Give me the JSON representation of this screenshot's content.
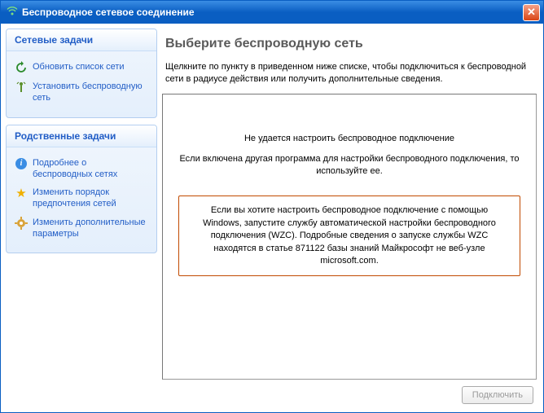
{
  "window": {
    "title": "Беспроводное сетевое соединение"
  },
  "sidebar": {
    "panel1": {
      "header": "Сетевые задачи",
      "items": [
        {
          "label": "Обновить список сети"
        },
        {
          "label": "Установить беспроводную сеть"
        }
      ]
    },
    "panel2": {
      "header": "Родственные задачи",
      "items": [
        {
          "label": "Подробнее о беспроводных сетях"
        },
        {
          "label": "Изменить порядок предпочтения  сетей"
        },
        {
          "label": "Изменить дополнительные параметры"
        }
      ]
    }
  },
  "main": {
    "title": "Выберите беспроводную сеть",
    "instruction": "Щелкните по пункту в приведенном ниже списке, чтобы подключиться к беспроводной сети в радиусе действия или получить дополнительные сведения.",
    "error_heading": "Не удается настроить беспроводное подключение",
    "error_detail": "Если включена другая программа для настройки беспроводного подключения, то\nиспользуйте ее.",
    "help_text": "Если вы хотите настроить беспроводное подключение с помощью Windows, запустите службу автоматической настройки беспроводного подключения (WZC). Подробные сведения о запуске службы WZC находятся в статье 871122 базы знаний Майкрософт не веб-узле microsoft.com."
  },
  "buttons": {
    "connect": "Подключить"
  }
}
